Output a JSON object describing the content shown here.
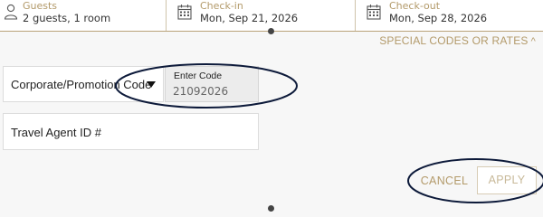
{
  "header": {
    "guests": {
      "label": "Guests",
      "value": "2 guests, 1 room",
      "icon": "person-icon"
    },
    "checkin": {
      "label": "Check-in",
      "value": "Mon, Sep 21, 2026",
      "icon": "calendar-icon"
    },
    "checkout": {
      "label": "Check-out",
      "value": "Mon, Sep 28, 2026",
      "icon": "calendar-icon"
    }
  },
  "special": {
    "toggle_label": "SPECIAL CODES OR RATES",
    "caret": "^",
    "code_type": "Corporate/Promotion Code",
    "code_label": "Enter Code",
    "code_value": "21092026",
    "agent_placeholder": "Travel Agent ID #",
    "agent_value": ""
  },
  "actions": {
    "cancel_label": "CANCEL",
    "apply_label": "APPLY"
  },
  "colors": {
    "accent_gold": "#b39a6a",
    "annotation": "#0d1a3a"
  }
}
